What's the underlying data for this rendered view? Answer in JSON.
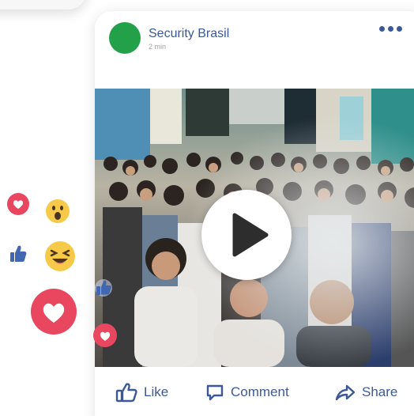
{
  "post": {
    "page_name": "Security Brasil",
    "time": "2 min",
    "avatar_color": "#22a04a"
  },
  "actions": {
    "like": "Like",
    "comment": "Comment",
    "share": "Share"
  },
  "colors": {
    "brand_blue": "#3b5998",
    "heart_pink": "#e8475f",
    "emoji_yellow": "#f7c948"
  },
  "reactions": [
    "heart-icon",
    "wow-emoji-icon",
    "thumbs-up-icon",
    "laughing-emoji-icon"
  ]
}
